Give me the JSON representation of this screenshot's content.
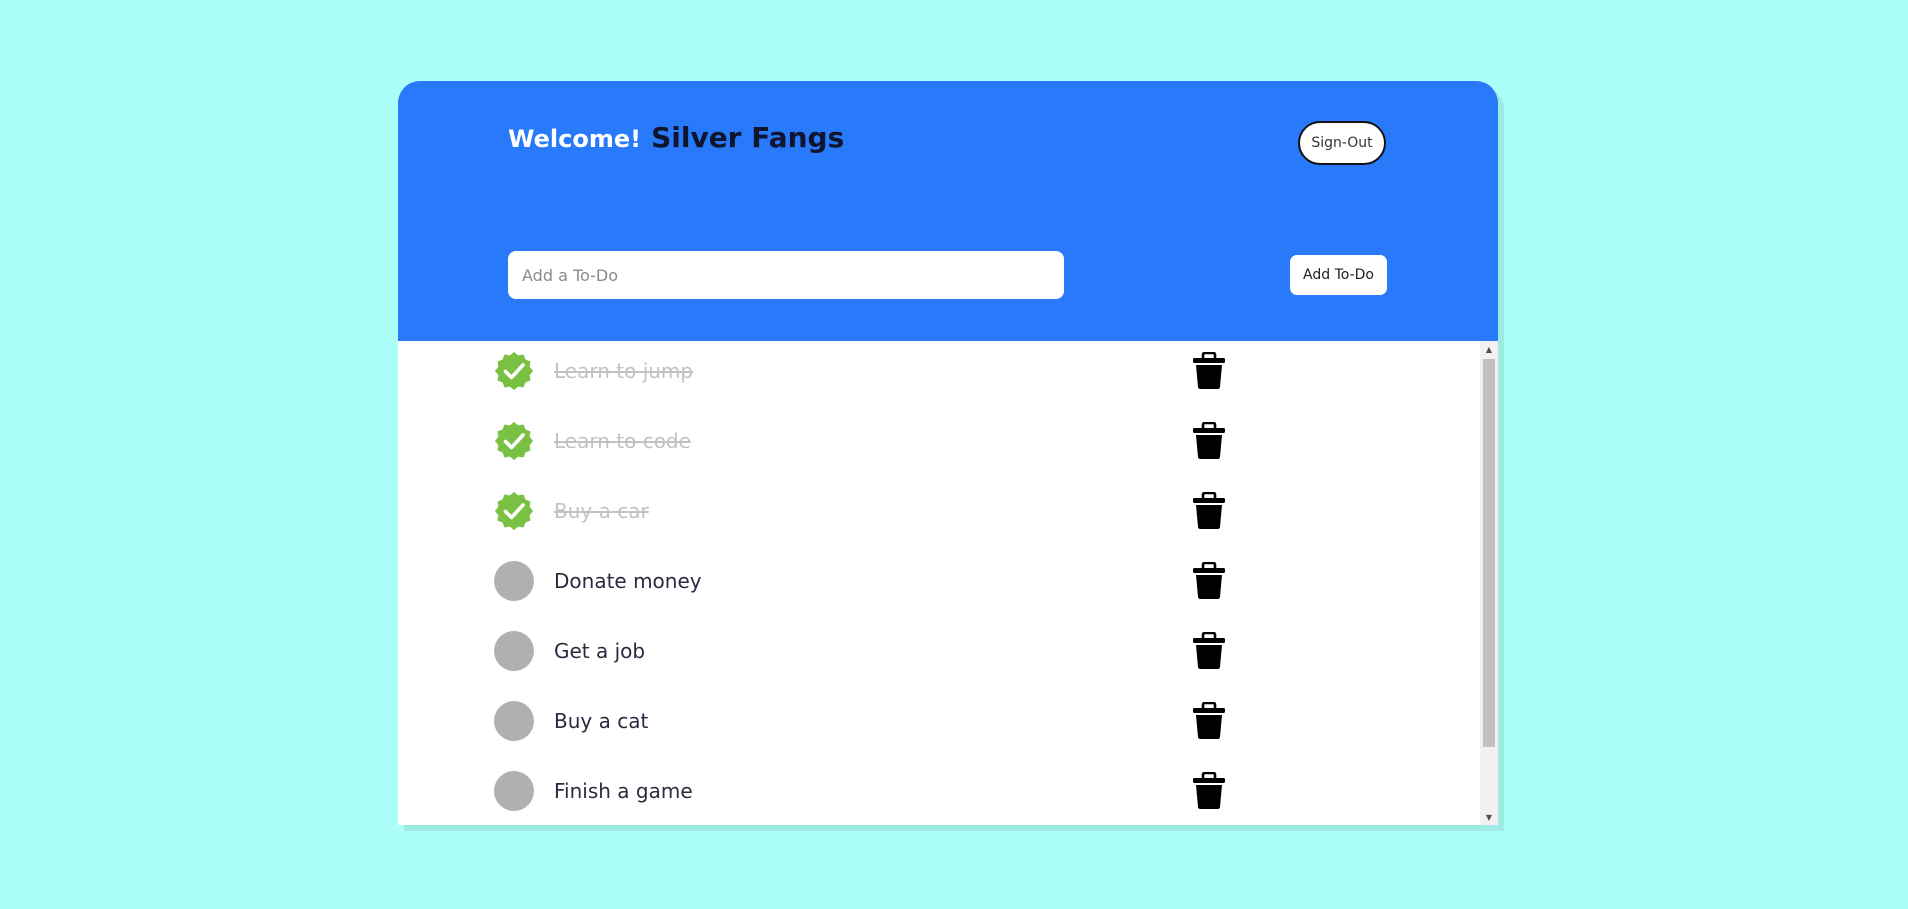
{
  "header": {
    "welcome_label": "Welcome!",
    "username": "Silver Fangs",
    "signout_label": "Sign-Out",
    "input_placeholder": "Add a To-Do",
    "input_value": "",
    "add_label": "Add To-Do"
  },
  "todos": [
    {
      "text": "Learn to jump",
      "done": true
    },
    {
      "text": "Learn to code",
      "done": true
    },
    {
      "text": "Buy a car",
      "done": true
    },
    {
      "text": "Donate money",
      "done": false
    },
    {
      "text": "Get a job",
      "done": false
    },
    {
      "text": "Buy a cat",
      "done": false
    },
    {
      "text": "Finish a game",
      "done": false
    }
  ],
  "icons": {
    "check_done": "check-badge-icon",
    "check_empty": "circle-icon",
    "delete": "trash-icon"
  },
  "colors": {
    "background": "#abfff8",
    "header": "#2979fb",
    "check_green": "#7ac143",
    "done_text": "#c2c2c2"
  }
}
